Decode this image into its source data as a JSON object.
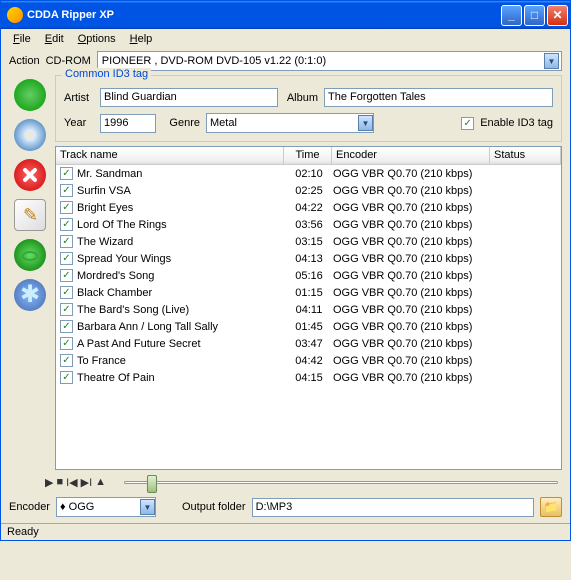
{
  "window": {
    "title": "CDDA Ripper XP"
  },
  "menu": {
    "file": "File",
    "edit": "Edit",
    "options": "Options",
    "help": "Help"
  },
  "labels": {
    "action": "Action",
    "cdrom": "CD-ROM",
    "common_id3": "Common ID3 tag",
    "artist": "Artist",
    "album": "Album",
    "year": "Year",
    "genre": "Genre",
    "enable_id3": "Enable ID3 tag",
    "encoder": "Encoder",
    "output_folder": "Output folder"
  },
  "cdrom": {
    "value": "PIONEER , DVD-ROM DVD-105  v1.22 (0:1:0)"
  },
  "id3": {
    "artist": "Blind Guardian",
    "album": "The Forgotten Tales",
    "year": "1996",
    "genre": "Metal",
    "enabled": true
  },
  "columns": {
    "name": "Track name",
    "time": "Time",
    "encoder": "Encoder",
    "status": "Status"
  },
  "tracks": [
    {
      "name": "Mr. Sandman",
      "time": "02:10",
      "encoder": "OGG VBR Q0.70 (210 kbps)"
    },
    {
      "name": "Surfin VSA",
      "time": "02:25",
      "encoder": "OGG VBR Q0.70 (210 kbps)"
    },
    {
      "name": "Bright Eyes",
      "time": "04:22",
      "encoder": "OGG VBR Q0.70 (210 kbps)"
    },
    {
      "name": "Lord Of The Rings",
      "time": "03:56",
      "encoder": "OGG VBR Q0.70 (210 kbps)"
    },
    {
      "name": "The Wizard",
      "time": "03:15",
      "encoder": "OGG VBR Q0.70 (210 kbps)"
    },
    {
      "name": "Spread Your Wings",
      "time": "04:13",
      "encoder": "OGG VBR Q0.70 (210 kbps)"
    },
    {
      "name": "Mordred's Song",
      "time": "05:16",
      "encoder": "OGG VBR Q0.70 (210 kbps)"
    },
    {
      "name": "Black Chamber",
      "time": "01:15",
      "encoder": "OGG VBR Q0.70 (210 kbps)"
    },
    {
      "name": "The Bard's Song (Live)",
      "time": "04:11",
      "encoder": "OGG VBR Q0.70 (210 kbps)"
    },
    {
      "name": "Barbara Ann / Long Tall Sally",
      "time": "01:45",
      "encoder": "OGG VBR Q0.70 (210 kbps)"
    },
    {
      "name": "A Past And Future Secret",
      "time": "03:47",
      "encoder": "OGG VBR Q0.70 (210 kbps)"
    },
    {
      "name": "To France",
      "time": "04:42",
      "encoder": "OGG VBR Q0.70 (210 kbps)"
    },
    {
      "name": "Theatre Of Pain",
      "time": "04:15",
      "encoder": "OGG VBR Q0.70 (210 kbps)"
    }
  ],
  "encoder": {
    "value": "OGG",
    "icon": "♦"
  },
  "output": {
    "folder": "D:\\MP3"
  },
  "status": "Ready"
}
